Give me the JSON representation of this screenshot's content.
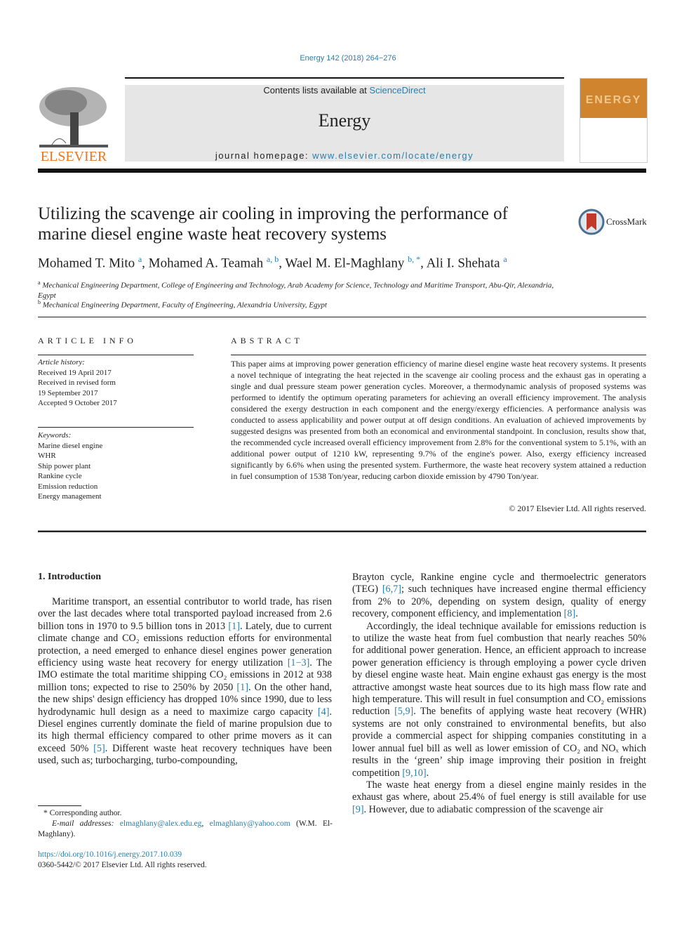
{
  "header": {
    "running_head": "Energy 142 (2018) 264−276",
    "contents_prefix": "Contents lists available at ",
    "contents_link": "ScienceDirect",
    "journal_name": "Energy",
    "homepage_prefix": "journal homepage: ",
    "homepage_link": "www.elsevier.com/locate/energy",
    "publisher_logo_text": "ELSEVIER",
    "cover_word": "ENERGY",
    "crossmark_label": "CrossMark"
  },
  "article": {
    "title": "Utilizing the scavenge air cooling in improving the performance of marine diesel engine waste heat recovery systems",
    "authors": [
      {
        "name": "Mohamed T. Mito",
        "sup": "a"
      },
      {
        "name": "Mohamed A. Teamah",
        "sup": "a, b"
      },
      {
        "name": "Wael M. El-Maghlany",
        "sup": "b, *"
      },
      {
        "name": "Ali I. Shehata",
        "sup": "a"
      }
    ],
    "affiliations": [
      {
        "mark": "a",
        "text": "Mechanical Engineering Department, College of Engineering and Technology, Arab Academy for Science, Technology and Maritime Transport, Abu-Qir, Alexandria, Egypt"
      },
      {
        "mark": "b",
        "text": "Mechanical Engineering Department, Faculty of Engineering, Alexandria University, Egypt"
      }
    ]
  },
  "article_info": {
    "heading": "ARTICLE INFO",
    "history_label": "Article history:",
    "history": [
      "Received 19 April 2017",
      "Received in revised form",
      "19 September 2017",
      "Accepted 9 October 2017"
    ],
    "keywords_label": "Keywords:",
    "keywords": [
      "Marine diesel engine",
      "WHR",
      "Ship power plant",
      "Rankine cycle",
      "Emission reduction",
      "Energy management"
    ]
  },
  "abstract": {
    "heading": "ABSTRACT",
    "text": "This paper aims at improving power generation efficiency of marine diesel engine waste heat recovery systems. It presents a novel technique of integrating the heat rejected in the scavenge air cooling process and the exhaust gas in operating a single and dual pressure steam power generation cycles. Moreover, a thermodynamic analysis of proposed systems was performed to identify the optimum operating parameters for achieving an overall efficiency improvement. The analysis considered the exergy destruction in each component and the energy/exergy efficiencies. A performance analysis was conducted to assess applicability and power output at off design conditions. An evaluation of achieved improvements by suggested designs was presented from both an economical and environmental standpoint. In conclusion, results show that, the recommended cycle increased overall efficiency improvement from 2.8% for the conventional system to 5.1%, with an additional power output of 1210 kW, representing 9.7% of the engine's power. Also, exergy efficiency increased significantly by 6.6% when using the presented system. Furthermore, the waste heat recovery system attained a reduction in fuel consumption of 1538 Ton/year, reducing carbon dioxide emission by 4790 Ton/year.",
    "copyright": "© 2017 Elsevier Ltd. All rights reserved."
  },
  "intro": {
    "heading": "1.  Introduction",
    "col1": [
      {
        "t": "Maritime transport, an essential contributor to world trade, has risen over the last decades where total transported payload increased from 2.6 billion tons in 1970 to 9.5 billion tons in 2013 "
      },
      {
        "ref": "[1]"
      },
      {
        "t": ". Lately, due to current climate change and CO₂ emissions reduction efforts for environmental protection, a need emerged to enhance diesel engines power generation efficiency using waste heat recovery for energy utilization "
      },
      {
        "ref": "[1−3]"
      },
      {
        "t": ". The IMO estimate the total maritime shipping CO₂ emissions in 2012 at 938 million tons; expected to rise to 250% by 2050 "
      },
      {
        "ref": "[1]"
      },
      {
        "t": ". On the other hand, the new ships' design efficiency has dropped 10% since 1990, due to less hydrodynamic hull design as a need to maximize cargo capacity "
      },
      {
        "ref": "[4]"
      },
      {
        "t": ". Diesel engines currently dominate the field of marine propulsion due to its high thermal efficiency compared to other prime movers as it can exceed 50% "
      },
      {
        "ref": "[5]"
      },
      {
        "t": ". Different waste heat recovery techniques have been used, such as; turbocharging, turbo-compounding,"
      }
    ],
    "col2_p1": [
      {
        "t": "Brayton cycle, Rankine engine cycle and thermoelectric generators (TEG) "
      },
      {
        "ref": "[6,7]"
      },
      {
        "t": "; such techniques have increased engine thermal efficiency from 2% to 20%, depending on system design, quality of energy recovery, component efficiency, and implementation "
      },
      {
        "ref": "[8]"
      },
      {
        "t": "."
      }
    ],
    "col2_p2": [
      {
        "t": "Accordingly, the ideal technique available for emissions reduction is to utilize the waste heat from fuel combustion that nearly reaches 50% for additional power generation. Hence, an efficient approach to increase power generation efficiency is through employing a power cycle driven by diesel engine waste heat. Main engine exhaust gas energy is the most attractive amongst waste heat sources due to its high mass flow rate and high temperature. This will result in fuel consumption and CO₂ emissions reduction "
      },
      {
        "ref": "[5,9]"
      },
      {
        "t": ". The benefits of applying waste heat recovery (WHR) systems are not only constrained to environmental benefits, but also provide a commercial aspect for shipping companies constituting in a lower annual fuel bill as well as lower emission of CO₂ and NOₓ which results in the ‘green’ ship image improving their position in freight competition "
      },
      {
        "ref": "[9,10]"
      },
      {
        "t": "."
      }
    ],
    "col2_p3": [
      {
        "t": "The waste heat energy from a diesel engine mainly resides in the exhaust gas where, about 25.4% of fuel energy is still available for use "
      },
      {
        "ref": "[9]"
      },
      {
        "t": ". However, due to adiabatic compression of the scavenge air"
      }
    ]
  },
  "footnotes": {
    "corresponding": "* Corresponding author.",
    "email_label": "E-mail addresses: ",
    "email1": "elmaghlany@alex.edu.eg",
    "email2": "elmaghlany@yahoo.com",
    "email_suffix": " (W.M. El-Maghlany).",
    "doi": "https://doi.org/10.1016/j.energy.2017.10.039",
    "issn": "0360-5442/© 2017 Elsevier Ltd. All rights reserved."
  }
}
